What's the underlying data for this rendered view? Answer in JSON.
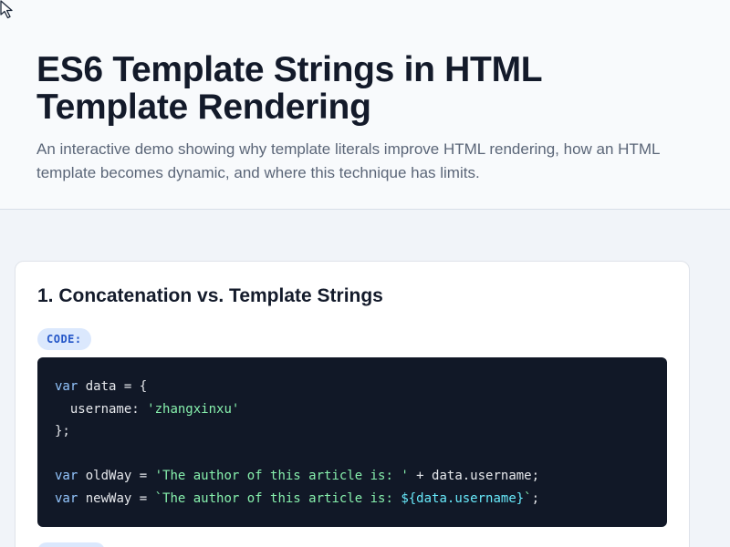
{
  "hero": {
    "title": "ES6 Template Strings in HTML Template Rendering",
    "subtitle": "An interactive demo showing why template literals improve HTML rendering, how an HTML template becomes dynamic, and where this technique has limits."
  },
  "section1": {
    "heading": "1. Concatenation vs. Template Strings",
    "code_badge": "CODE:",
    "code": {
      "l1_kw": "var",
      "l1_rest": " data = {",
      "l2_pre": "  username: ",
      "l2_str": "'zhangxinxu'",
      "l3": "};",
      "l5_kw": "var",
      "l5_mid": " oldWay = ",
      "l5_str": "'The author of this article is: '",
      "l5_rest": " + data.username;",
      "l6_kw": "var",
      "l6_mid": " newWay = ",
      "l6_str": "`The author of this article is: ",
      "l6_interp": "${data.username}",
      "l6_tick": "`",
      "l6_end": ";"
    }
  },
  "colors": {
    "accent": "#2456c8",
    "code_bg": "#111827",
    "keyword": "#93c5fd",
    "string": "#86efac",
    "interpolation": "#67e8f9"
  },
  "icons": {
    "cursor": "mouse-pointer-icon"
  }
}
